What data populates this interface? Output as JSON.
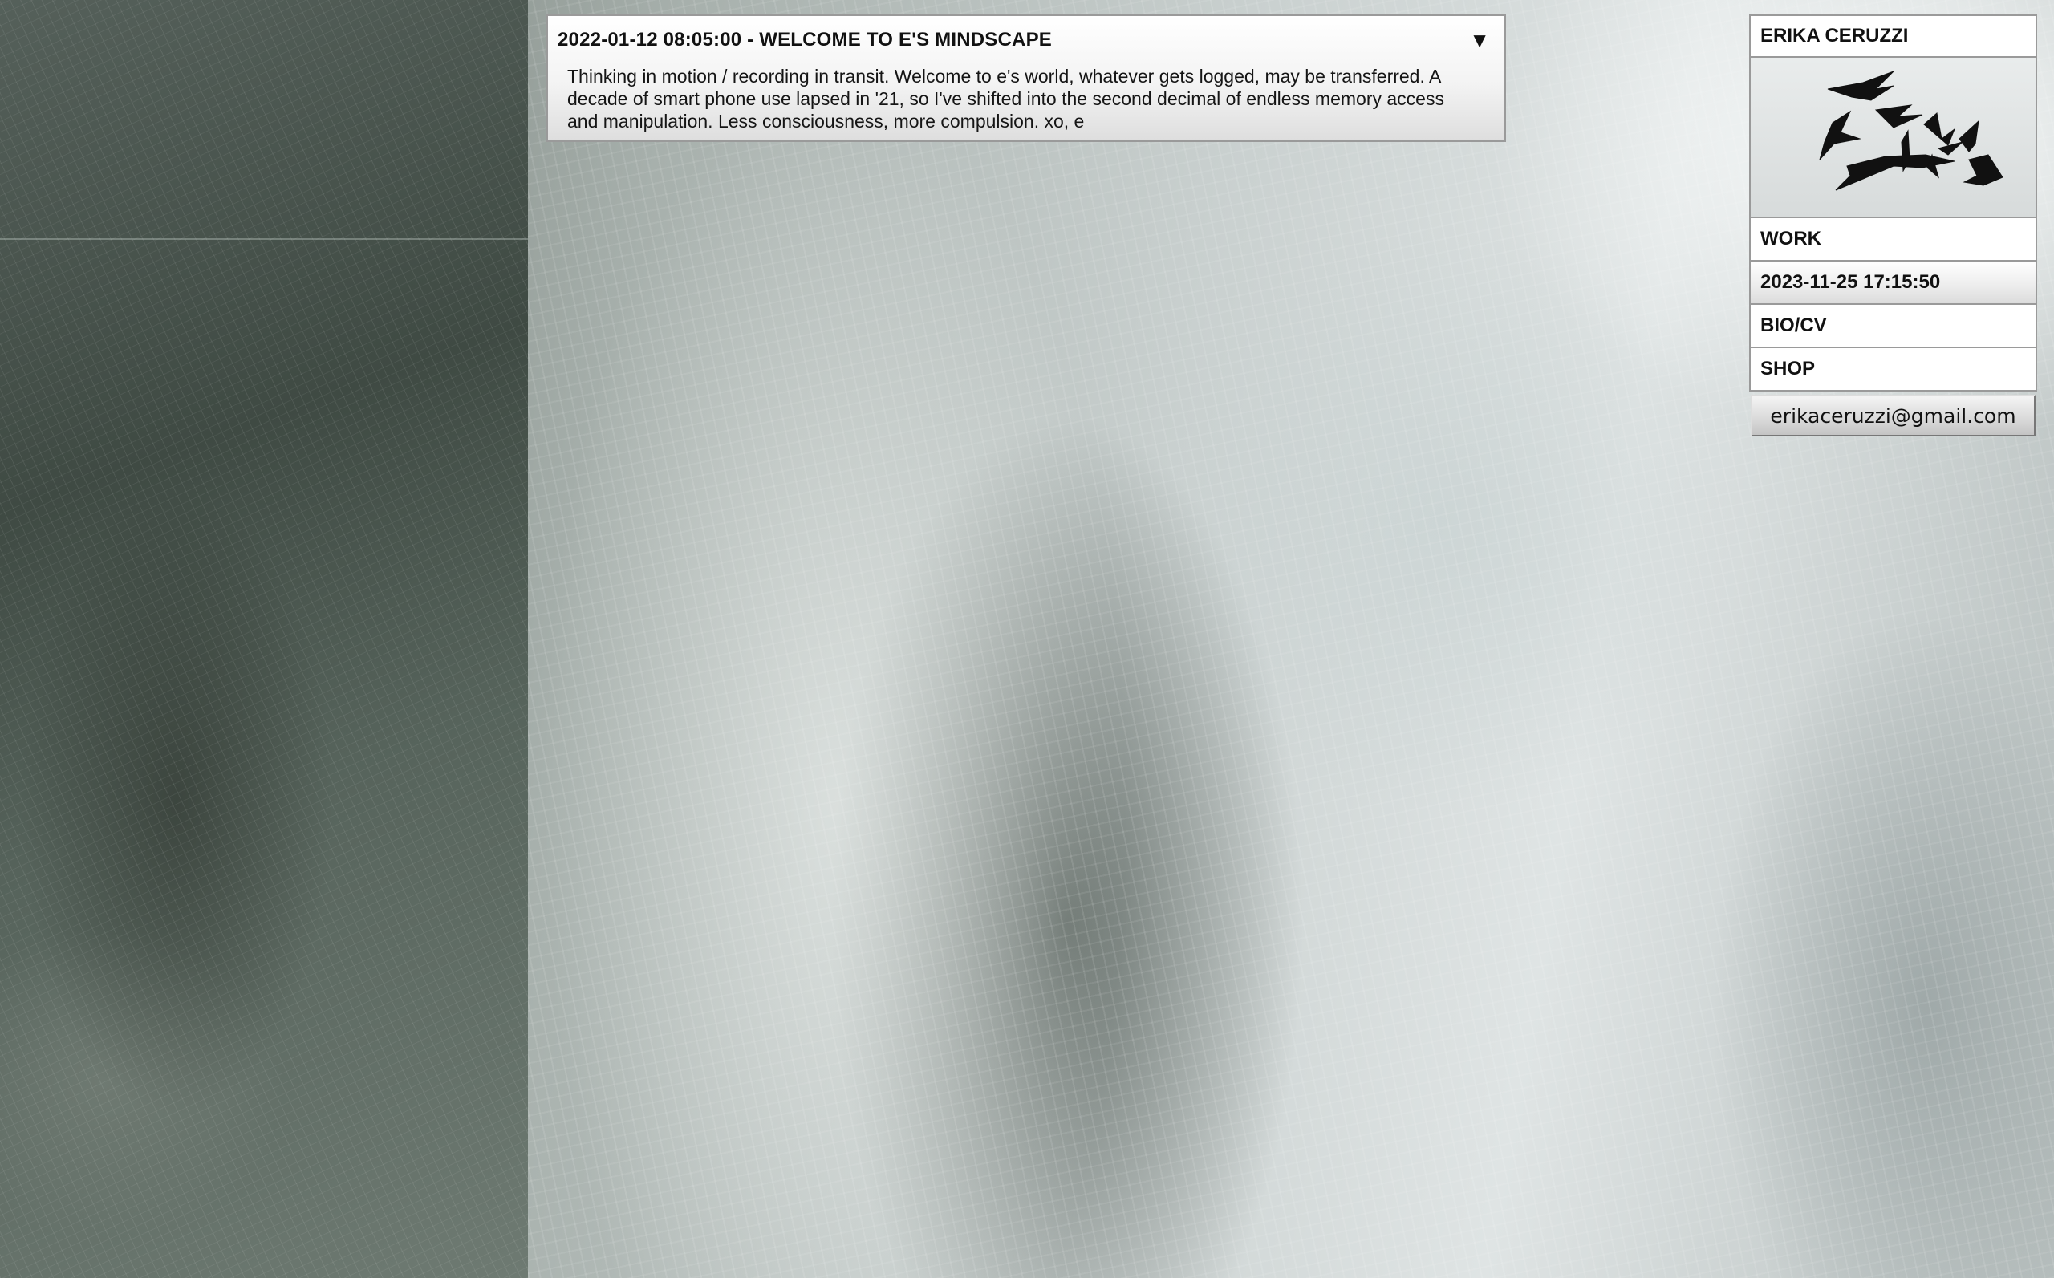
{
  "post": {
    "title": "2022-01-12 08:05:00 - WELCOME TO E'S MINDSCAPE",
    "toggle_icon": "triangle-down-icon",
    "body": "Thinking in motion / recording in transit. Welcome to e's world, whatever gets logged, may be transferred. A decade of smart phone use lapsed in '21, so I've shifted into the second decimal of endless memory access and manipulation. Less consciousness, more compulsion. xo, e"
  },
  "nav": {
    "name": "ERIKA CERUZZI",
    "logo_text": "ERIKA",
    "items": [
      {
        "label": "WORK"
      },
      {
        "label": "2023-11-25 17:15:50"
      },
      {
        "label": "BIO/CV"
      },
      {
        "label": "SHOP"
      }
    ],
    "email": "erikaceruzzi@gmail.com"
  },
  "colors": {
    "panel_border": "#9a9a9a",
    "panel_bg": "#ffffff",
    "text": "#111111",
    "background_tone": "#6f7a72"
  }
}
